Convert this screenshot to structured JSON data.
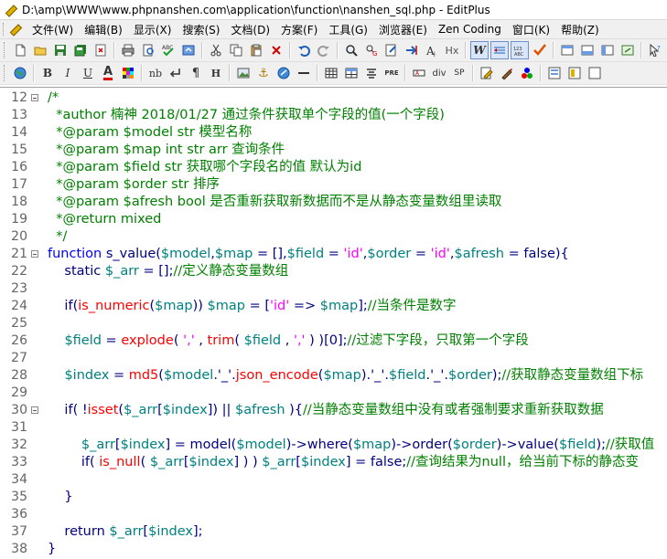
{
  "window": {
    "title": "D:\\amp\\WWW\\www.phpnanshen.com\\application\\function\\nanshen_sql.php - EditPlus"
  },
  "menu": {
    "items": [
      "文件(W)",
      "编辑(B)",
      "显示(X)",
      "搜索(S)",
      "文档(D)",
      "方案(F)",
      "工具(G)",
      "浏览器(E)",
      "Zen Coding",
      "窗口(K)",
      "帮助(Z)"
    ]
  },
  "toolbar2": {
    "bold_label": "B",
    "italic_label": "I",
    "underline_label": "U",
    "font_color_label": "A",
    "nb_label": "nb",
    "h1_label": "H",
    "pre_label": "PRE",
    "div_label": "div",
    "sp_label": "SP"
  },
  "toolbar1": {
    "hx_label": "Hx",
    "w_label": "W"
  },
  "colors": {
    "comment": "#008000",
    "keyword": "#0000ff",
    "variable": "#008080",
    "string": "#ff00ff",
    "function": "#ff0000",
    "text": "#000080"
  },
  "editor": {
    "lines": [
      {
        "n": "12",
        "fold": true,
        "parts": [
          {
            "t": "/*",
            "c": "cmt"
          }
        ]
      },
      {
        "n": "13",
        "parts": [
          {
            "t": "  *author 楠神 2018/01/27 通过条件获取单个字段的值(一个字段)",
            "c": "cmt"
          }
        ]
      },
      {
        "n": "14",
        "parts": [
          {
            "t": "  *@param $model str 模型名称",
            "c": "cmt"
          }
        ]
      },
      {
        "n": "15",
        "parts": [
          {
            "t": "  *@param $map int str arr 查询条件",
            "c": "cmt"
          }
        ]
      },
      {
        "n": "16",
        "parts": [
          {
            "t": "  *@param $field str 获取哪个字段名的值 默认为id",
            "c": "cmt"
          }
        ]
      },
      {
        "n": "17",
        "parts": [
          {
            "t": "  *@param $order str 排序",
            "c": "cmt"
          }
        ]
      },
      {
        "n": "18",
        "parts": [
          {
            "t": "  *@param $afresh bool 是否重新获取新数据而不是从静态变量数组里读取",
            "c": "cmt"
          }
        ]
      },
      {
        "n": "19",
        "parts": [
          {
            "t": "  *@return mixed",
            "c": "cmt"
          }
        ]
      },
      {
        "n": "20",
        "parts": [
          {
            "t": "  */",
            "c": "cmt"
          }
        ]
      },
      {
        "n": "21",
        "fold": true,
        "parts": [
          {
            "t": "function ",
            "c": "kw"
          },
          {
            "t": "s_value(",
            "c": "txt"
          },
          {
            "t": "$model",
            "c": "var"
          },
          {
            "t": ",",
            "c": "txt"
          },
          {
            "t": "$map",
            "c": "var"
          },
          {
            "t": " = [],",
            "c": "txt"
          },
          {
            "t": "$field",
            "c": "var"
          },
          {
            "t": " = ",
            "c": "txt"
          },
          {
            "t": "'id'",
            "c": "str"
          },
          {
            "t": ",",
            "c": "txt"
          },
          {
            "t": "$order",
            "c": "var"
          },
          {
            "t": " = ",
            "c": "txt"
          },
          {
            "t": "'id'",
            "c": "str"
          },
          {
            "t": ",",
            "c": "txt"
          },
          {
            "t": "$afresh",
            "c": "var"
          },
          {
            "t": " = false){",
            "c": "txt"
          }
        ]
      },
      {
        "n": "22",
        "parts": [
          {
            "t": "    static ",
            "c": "txt"
          },
          {
            "t": "$_arr",
            "c": "var"
          },
          {
            "t": " = [];",
            "c": "txt"
          },
          {
            "t": "//定义静态变量数组",
            "c": "cmt"
          }
        ]
      },
      {
        "n": "23",
        "parts": []
      },
      {
        "n": "24",
        "parts": [
          {
            "t": "    if(",
            "c": "txt"
          },
          {
            "t": "is_numeric",
            "c": "fn"
          },
          {
            "t": "(",
            "c": "txt"
          },
          {
            "t": "$map",
            "c": "var"
          },
          {
            "t": ")) ",
            "c": "txt"
          },
          {
            "t": "$map",
            "c": "var"
          },
          {
            "t": " = [",
            "c": "txt"
          },
          {
            "t": "'id'",
            "c": "str"
          },
          {
            "t": " => ",
            "c": "txt"
          },
          {
            "t": "$map",
            "c": "var"
          },
          {
            "t": "];",
            "c": "txt"
          },
          {
            "t": "//当条件是数字",
            "c": "cmt"
          }
        ]
      },
      {
        "n": "25",
        "parts": []
      },
      {
        "n": "26",
        "parts": [
          {
            "t": "    ",
            "c": "txt"
          },
          {
            "t": "$field",
            "c": "var"
          },
          {
            "t": " = ",
            "c": "txt"
          },
          {
            "t": "explode",
            "c": "fn"
          },
          {
            "t": "( ",
            "c": "txt"
          },
          {
            "t": "','",
            "c": "str"
          },
          {
            "t": " , ",
            "c": "txt"
          },
          {
            "t": "trim",
            "c": "fn"
          },
          {
            "t": "( ",
            "c": "txt"
          },
          {
            "t": "$field",
            "c": "var"
          },
          {
            "t": " , ",
            "c": "txt"
          },
          {
            "t": "','",
            "c": "str"
          },
          {
            "t": " ) )[0];",
            "c": "txt"
          },
          {
            "t": "//过滤下字段，只取第一个字段",
            "c": "cmt"
          }
        ]
      },
      {
        "n": "27",
        "parts": []
      },
      {
        "n": "28",
        "parts": [
          {
            "t": "    ",
            "c": "txt"
          },
          {
            "t": "$index",
            "c": "var"
          },
          {
            "t": " = ",
            "c": "txt"
          },
          {
            "t": "md5",
            "c": "fn"
          },
          {
            "t": "(",
            "c": "txt"
          },
          {
            "t": "$model",
            "c": "var"
          },
          {
            "t": ".'_'.",
            "c": "txt"
          },
          {
            "t": "json_encode",
            "c": "fn"
          },
          {
            "t": "(",
            "c": "txt"
          },
          {
            "t": "$map",
            "c": "var"
          },
          {
            "t": ").'_'.",
            "c": "txt"
          },
          {
            "t": "$field",
            "c": "var"
          },
          {
            "t": ".'_'.",
            "c": "txt"
          },
          {
            "t": "$order",
            "c": "var"
          },
          {
            "t": ");",
            "c": "txt"
          },
          {
            "t": "//获取静态变量数组下标",
            "c": "cmt"
          }
        ]
      },
      {
        "n": "29",
        "parts": []
      },
      {
        "n": "30",
        "fold": true,
        "parts": [
          {
            "t": "    if( !",
            "c": "txt"
          },
          {
            "t": "isset",
            "c": "fn"
          },
          {
            "t": "(",
            "c": "txt"
          },
          {
            "t": "$_arr",
            "c": "var"
          },
          {
            "t": "[",
            "c": "txt"
          },
          {
            "t": "$index",
            "c": "var"
          },
          {
            "t": "]) || ",
            "c": "txt"
          },
          {
            "t": "$afresh",
            "c": "var"
          },
          {
            "t": " ){",
            "c": "txt"
          },
          {
            "t": "//当静态变量数组中没有或者强制要求重新获取数据",
            "c": "cmt"
          }
        ]
      },
      {
        "n": "31",
        "parts": []
      },
      {
        "n": "32",
        "parts": [
          {
            "t": "        ",
            "c": "txt"
          },
          {
            "t": "$_arr",
            "c": "var"
          },
          {
            "t": "[",
            "c": "txt"
          },
          {
            "t": "$index",
            "c": "var"
          },
          {
            "t": "] = model(",
            "c": "txt"
          },
          {
            "t": "$model",
            "c": "var"
          },
          {
            "t": ")->where(",
            "c": "txt"
          },
          {
            "t": "$map",
            "c": "var"
          },
          {
            "t": ")->order(",
            "c": "txt"
          },
          {
            "t": "$order",
            "c": "var"
          },
          {
            "t": ")->value(",
            "c": "txt"
          },
          {
            "t": "$field",
            "c": "var"
          },
          {
            "t": ");",
            "c": "txt"
          },
          {
            "t": "//获取值",
            "c": "cmt"
          }
        ]
      },
      {
        "n": "33",
        "parts": [
          {
            "t": "        if( ",
            "c": "txt"
          },
          {
            "t": "is_null",
            "c": "fn"
          },
          {
            "t": "( ",
            "c": "txt"
          },
          {
            "t": "$_arr",
            "c": "var"
          },
          {
            "t": "[",
            "c": "txt"
          },
          {
            "t": "$index",
            "c": "var"
          },
          {
            "t": "] ) ) ",
            "c": "txt"
          },
          {
            "t": "$_arr",
            "c": "var"
          },
          {
            "t": "[",
            "c": "txt"
          },
          {
            "t": "$index",
            "c": "var"
          },
          {
            "t": "] = false;",
            "c": "txt"
          },
          {
            "t": "//查询结果为null，给当前下标的静态变",
            "c": "cmt"
          }
        ]
      },
      {
        "n": "34",
        "parts": []
      },
      {
        "n": "35",
        "parts": [
          {
            "t": "    }",
            "c": "txt"
          }
        ]
      },
      {
        "n": "36",
        "parts": []
      },
      {
        "n": "37",
        "parts": [
          {
            "t": "    return ",
            "c": "txt"
          },
          {
            "t": "$_arr",
            "c": "var"
          },
          {
            "t": "[",
            "c": "txt"
          },
          {
            "t": "$index",
            "c": "var"
          },
          {
            "t": "];",
            "c": "txt"
          }
        ]
      },
      {
        "n": "38",
        "parts": [
          {
            "t": "}",
            "c": "txt"
          }
        ]
      }
    ]
  }
}
